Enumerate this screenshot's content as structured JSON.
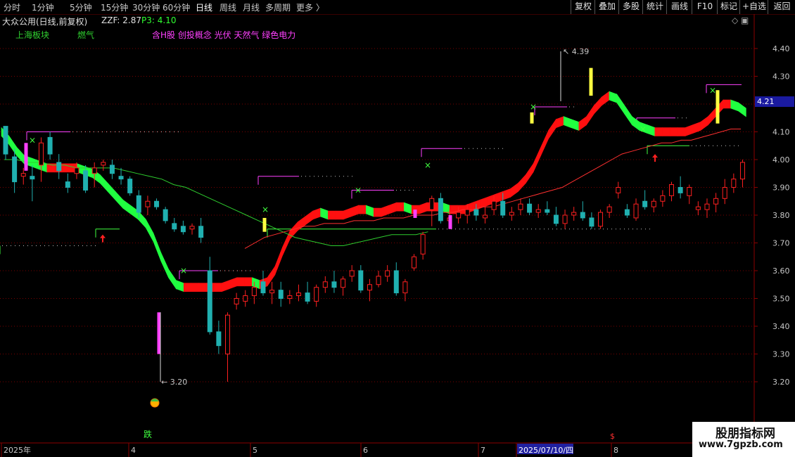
{
  "toolbar": {
    "periods": [
      "分时",
      "1分钟",
      "5分钟",
      "15分钟",
      "30分钟",
      "60分钟",
      "日线",
      "周线",
      "月线",
      "多周期",
      "更多"
    ],
    "active_period": "日线",
    "more_arrow": "〉",
    "right_buttons": [
      "复权",
      "叠加",
      "多股",
      "统计",
      "画线",
      "F10",
      "标记",
      "+自选",
      "返回"
    ]
  },
  "info": {
    "stock_title": "大众公用(日线,前复权)",
    "zzf_label": "ZZF: 2.87",
    "p3_label": "P3: 4.10",
    "sector_1": "上海板块",
    "sector_2": "燃气",
    "concepts": "含H股 创投概念 光伏 天然气 绿色电力",
    "corner_icons": "◇ ▣"
  },
  "colors": {
    "up": "#ff2020",
    "down": "#20b0b0",
    "ma_fast_up": "#ff1010",
    "ma_fast_down": "#20ff40",
    "ma_slow": "#2ecc2e",
    "ma_red": "#ff3030",
    "magenta": "#ff40ff",
    "yellow": "#ffff40",
    "axis_red": "#8b0000",
    "current_price_bg": "#1a1aa0"
  },
  "chart_data": {
    "type": "candlestick",
    "y_ticks": [
      "4.40",
      "4.30",
      "4.20",
      "4.10",
      "4.00",
      "3.90",
      "3.80",
      "3.70",
      "3.60",
      "3.50",
      "3.40",
      "3.30",
      "3.20"
    ],
    "ylim": [
      3.1,
      4.47
    ],
    "current_price": "4.21",
    "x_ticks": [
      "2025年",
      "4",
      "5",
      "6",
      "7",
      "2025/07/10/四",
      "8"
    ],
    "high_annotation": "4.39",
    "low_annotation": "3.20",
    "bottom_signal": "跌",
    "ma_fast": [
      4.1,
      4.07,
      4.03,
      4.0,
      3.99,
      3.98,
      3.97,
      3.97,
      3.97,
      3.97,
      3.97,
      3.96,
      3.95,
      3.93,
      3.9,
      3.87,
      3.84,
      3.82,
      3.8,
      3.77,
      3.72,
      3.65,
      3.59,
      3.55,
      3.54,
      3.54,
      3.54,
      3.54,
      3.54,
      3.54,
      3.55,
      3.56,
      3.56,
      3.56,
      3.55,
      3.56,
      3.6,
      3.67,
      3.73,
      3.76,
      3.78,
      3.8,
      3.81,
      3.8,
      3.8,
      3.8,
      3.81,
      3.82,
      3.82,
      3.81,
      3.81,
      3.82,
      3.83,
      3.83,
      3.82,
      3.82,
      3.83,
      3.83,
      3.83,
      3.82,
      3.82,
      3.82,
      3.83,
      3.84,
      3.85,
      3.86,
      3.87,
      3.88,
      3.9,
      3.93,
      3.97,
      4.03,
      4.09,
      4.13,
      4.14,
      4.13,
      4.12,
      4.14,
      4.18,
      4.21,
      4.23,
      4.22,
      4.18,
      4.14,
      4.12,
      4.11,
      4.1,
      4.1,
      4.1,
      4.1,
      4.1,
      4.11,
      4.12,
      4.14,
      4.17,
      4.2,
      4.2,
      4.19,
      4.17
    ],
    "ma_slow": [
      4.0,
      4.0,
      3.99,
      3.99,
      3.98,
      3.98,
      3.97,
      3.97,
      3.97,
      3.97,
      3.96,
      3.95,
      3.94,
      3.93,
      3.91,
      3.9,
      3.88,
      3.86,
      3.84,
      3.82,
      3.8,
      3.78,
      3.76,
      3.74,
      3.72,
      3.71,
      3.7,
      3.69,
      3.69,
      3.7,
      3.71,
      3.72,
      3.73,
      3.73,
      3.73,
      3.74
    ],
    "ma_red": [
      3.68,
      3.7,
      3.72,
      3.73,
      3.74,
      3.75,
      3.76,
      3.76,
      3.77,
      3.77,
      3.77,
      3.78,
      3.78,
      3.78,
      3.79,
      3.79,
      3.79,
      3.8,
      3.8,
      3.8,
      3.81,
      3.81,
      3.82,
      3.82,
      3.83,
      3.83,
      3.84,
      3.85,
      3.86,
      3.87,
      3.88,
      3.89,
      3.9,
      3.92,
      3.94,
      3.96,
      3.98,
      4.0,
      4.02,
      4.03,
      4.04,
      4.05,
      4.06,
      4.06,
      4.07,
      4.07,
      4.08,
      4.09,
      4.1,
      4.11,
      4.11
    ],
    "candles": [
      {
        "o": 4.12,
        "h": 4.12,
        "l": 4.0,
        "c": 4.02
      },
      {
        "o": 4.01,
        "h": 4.04,
        "l": 3.88,
        "c": 3.92
      },
      {
        "o": 3.94,
        "h": 3.97,
        "l": 3.91,
        "c": 3.95
      },
      {
        "o": 3.94,
        "h": 3.98,
        "l": 3.85,
        "c": 3.93
      },
      {
        "o": 3.98,
        "h": 4.08,
        "l": 3.92,
        "c": 4.06
      },
      {
        "o": 4.08,
        "h": 4.1,
        "l": 4.0,
        "c": 4.02
      },
      {
        "o": 3.99,
        "h": 4.02,
        "l": 3.93,
        "c": 3.96
      },
      {
        "o": 3.92,
        "h": 3.95,
        "l": 3.88,
        "c": 3.9
      },
      {
        "o": 3.95,
        "h": 3.99,
        "l": 3.93,
        "c": 3.97
      },
      {
        "o": 3.96,
        "h": 3.98,
        "l": 3.88,
        "c": 3.89
      },
      {
        "o": 3.95,
        "h": 3.99,
        "l": 3.9,
        "c": 3.97
      },
      {
        "o": 3.98,
        "h": 4.0,
        "l": 3.96,
        "c": 3.99
      },
      {
        "o": 3.98,
        "h": 4.0,
        "l": 3.93,
        "c": 3.95
      },
      {
        "o": 3.94,
        "h": 3.97,
        "l": 3.91,
        "c": 3.93
      },
      {
        "o": 3.93,
        "h": 3.94,
        "l": 3.87,
        "c": 3.88
      },
      {
        "o": 3.87,
        "h": 3.89,
        "l": 3.79,
        "c": 3.81
      },
      {
        "o": 3.83,
        "h": 3.87,
        "l": 3.8,
        "c": 3.85
      },
      {
        "o": 3.85,
        "h": 3.86,
        "l": 3.82,
        "c": 3.83
      },
      {
        "o": 3.82,
        "h": 3.83,
        "l": 3.77,
        "c": 3.78
      },
      {
        "o": 3.77,
        "h": 3.79,
        "l": 3.74,
        "c": 3.75
      },
      {
        "o": 3.76,
        "h": 3.78,
        "l": 3.73,
        "c": 3.74
      },
      {
        "o": 3.75,
        "h": 3.77,
        "l": 3.73,
        "c": 3.76
      },
      {
        "o": 3.76,
        "h": 3.79,
        "l": 3.7,
        "c": 3.72
      },
      {
        "o": 3.6,
        "h": 3.65,
        "l": 3.37,
        "c": 3.38
      },
      {
        "o": 3.38,
        "h": 3.42,
        "l": 3.3,
        "c": 3.33
      },
      {
        "o": 3.3,
        "h": 3.45,
        "l": 3.2,
        "c": 3.44
      },
      {
        "o": 3.48,
        "h": 3.52,
        "l": 3.46,
        "c": 3.5
      },
      {
        "o": 3.49,
        "h": 3.53,
        "l": 3.47,
        "c": 3.51
      },
      {
        "o": 3.51,
        "h": 3.56,
        "l": 3.48,
        "c": 3.54
      },
      {
        "o": 3.56,
        "h": 3.6,
        "l": 3.51,
        "c": 3.52
      },
      {
        "o": 3.52,
        "h": 3.56,
        "l": 3.48,
        "c": 3.53
      },
      {
        "o": 3.53,
        "h": 3.56,
        "l": 3.47,
        "c": 3.5
      },
      {
        "o": 3.5,
        "h": 3.53,
        "l": 3.48,
        "c": 3.51
      },
      {
        "o": 3.51,
        "h": 3.55,
        "l": 3.49,
        "c": 3.52
      },
      {
        "o": 3.52,
        "h": 3.56,
        "l": 3.48,
        "c": 3.49
      },
      {
        "o": 3.49,
        "h": 3.55,
        "l": 3.47,
        "c": 3.54
      },
      {
        "o": 3.54,
        "h": 3.58,
        "l": 3.52,
        "c": 3.56
      },
      {
        "o": 3.56,
        "h": 3.6,
        "l": 3.52,
        "c": 3.54
      },
      {
        "o": 3.54,
        "h": 3.58,
        "l": 3.51,
        "c": 3.57
      },
      {
        "o": 3.58,
        "h": 3.62,
        "l": 3.56,
        "c": 3.6
      },
      {
        "o": 3.6,
        "h": 3.62,
        "l": 3.52,
        "c": 3.53
      },
      {
        "o": 3.53,
        "h": 3.57,
        "l": 3.49,
        "c": 3.55
      },
      {
        "o": 3.55,
        "h": 3.6,
        "l": 3.54,
        "c": 3.58
      },
      {
        "o": 3.58,
        "h": 3.62,
        "l": 3.56,
        "c": 3.6
      },
      {
        "o": 3.6,
        "h": 3.63,
        "l": 3.51,
        "c": 3.52
      },
      {
        "o": 3.52,
        "h": 3.57,
        "l": 3.49,
        "c": 3.56
      },
      {
        "o": 3.61,
        "h": 3.66,
        "l": 3.6,
        "c": 3.65
      },
      {
        "o": 3.66,
        "h": 3.74,
        "l": 3.64,
        "c": 3.73
      },
      {
        "o": 3.82,
        "h": 3.87,
        "l": 3.76,
        "c": 3.86
      },
      {
        "o": 3.86,
        "h": 3.88,
        "l": 3.77,
        "c": 3.78
      },
      {
        "o": 3.78,
        "h": 3.82,
        "l": 3.76,
        "c": 3.79
      },
      {
        "o": 3.79,
        "h": 3.83,
        "l": 3.77,
        "c": 3.81
      },
      {
        "o": 3.8,
        "h": 3.84,
        "l": 3.77,
        "c": 3.82
      },
      {
        "o": 3.82,
        "h": 3.84,
        "l": 3.78,
        "c": 3.8
      },
      {
        "o": 3.79,
        "h": 3.83,
        "l": 3.77,
        "c": 3.8
      },
      {
        "o": 3.82,
        "h": 3.87,
        "l": 3.8,
        "c": 3.85
      },
      {
        "o": 3.85,
        "h": 3.88,
        "l": 3.79,
        "c": 3.8
      },
      {
        "o": 3.8,
        "h": 3.83,
        "l": 3.78,
        "c": 3.81
      },
      {
        "o": 3.82,
        "h": 3.86,
        "l": 3.8,
        "c": 3.84
      },
      {
        "o": 3.84,
        "h": 3.86,
        "l": 3.8,
        "c": 3.81
      },
      {
        "o": 3.81,
        "h": 3.84,
        "l": 3.79,
        "c": 3.82
      },
      {
        "o": 3.82,
        "h": 3.85,
        "l": 3.8,
        "c": 3.81
      },
      {
        "o": 3.8,
        "h": 3.83,
        "l": 3.76,
        "c": 3.77
      },
      {
        "o": 3.77,
        "h": 3.82,
        "l": 3.75,
        "c": 3.8
      },
      {
        "o": 3.8,
        "h": 3.83,
        "l": 3.78,
        "c": 3.81
      },
      {
        "o": 3.81,
        "h": 3.85,
        "l": 3.78,
        "c": 3.79
      },
      {
        "o": 3.79,
        "h": 3.81,
        "l": 3.75,
        "c": 3.76
      },
      {
        "o": 3.76,
        "h": 3.82,
        "l": 3.75,
        "c": 3.81
      },
      {
        "o": 3.81,
        "h": 3.84,
        "l": 3.79,
        "c": 3.83
      },
      {
        "o": 3.88,
        "h": 3.92,
        "l": 3.86,
        "c": 3.9
      },
      {
        "o": 3.82,
        "h": 3.84,
        "l": 3.79,
        "c": 3.8
      },
      {
        "o": 3.79,
        "h": 3.86,
        "l": 3.78,
        "c": 3.84
      },
      {
        "o": 3.85,
        "h": 3.89,
        "l": 3.82,
        "c": 3.83
      },
      {
        "o": 3.83,
        "h": 3.86,
        "l": 3.81,
        "c": 3.85
      },
      {
        "o": 3.85,
        "h": 3.89,
        "l": 3.83,
        "c": 3.87
      },
      {
        "o": 3.87,
        "h": 3.92,
        "l": 3.85,
        "c": 3.91
      },
      {
        "o": 3.9,
        "h": 3.94,
        "l": 3.86,
        "c": 3.88
      },
      {
        "o": 3.87,
        "h": 3.91,
        "l": 3.84,
        "c": 3.9
      },
      {
        "o": 3.82,
        "h": 3.85,
        "l": 3.8,
        "c": 3.83
      },
      {
        "o": 3.82,
        "h": 3.86,
        "l": 3.79,
        "c": 3.84
      },
      {
        "o": 3.84,
        "h": 3.88,
        "l": 3.81,
        "c": 3.86
      },
      {
        "o": 3.86,
        "h": 3.93,
        "l": 3.84,
        "c": 3.9
      },
      {
        "o": 3.9,
        "h": 3.95,
        "l": 3.88,
        "c": 3.93
      },
      {
        "o": 3.93,
        "h": 4.0,
        "l": 3.9,
        "c": 3.99
      }
    ]
  }
}
